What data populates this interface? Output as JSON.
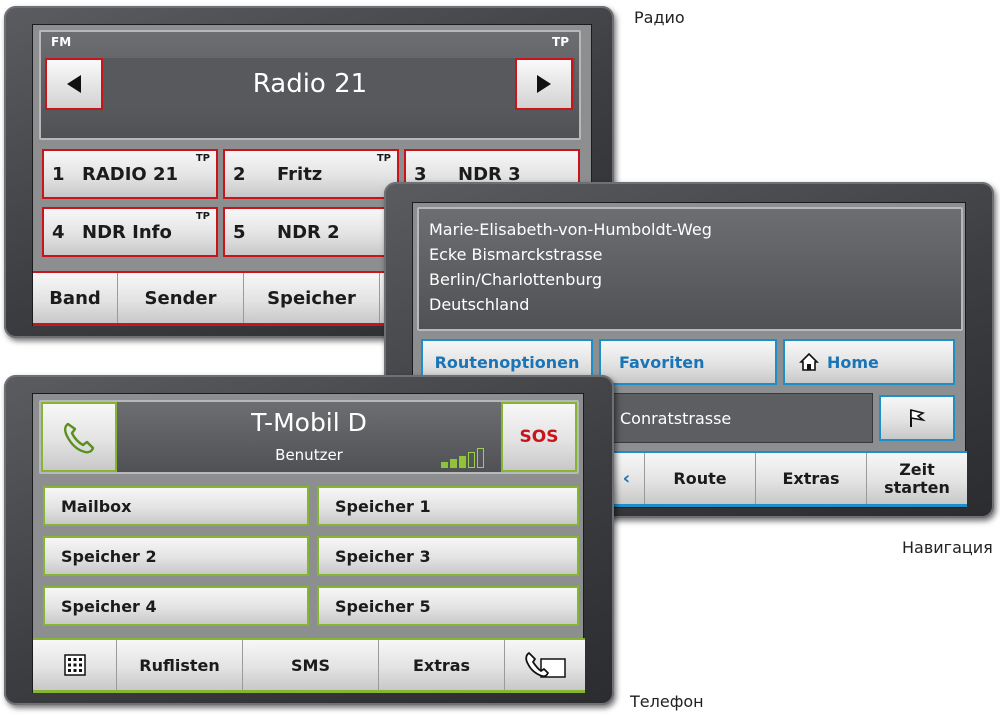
{
  "captions": {
    "radio": "Радио",
    "navigation": "Навигация",
    "phone": "Телефон"
  },
  "radio": {
    "band_indicator": "FM",
    "tp_indicator": "TP",
    "station_name": "Radio 21",
    "presets": [
      {
        "number": "1",
        "name": "RADIO 21",
        "tp": "TP"
      },
      {
        "number": "2",
        "name": "Fritz",
        "tp": "TP"
      },
      {
        "number": "3",
        "name": "NDR 3",
        "tp": ""
      },
      {
        "number": "4",
        "name": "NDR Info",
        "tp": "TP"
      },
      {
        "number": "5",
        "name": "NDR 2",
        "tp": ""
      }
    ],
    "bottom_tabs": [
      "Band",
      "Sender",
      "Speicher"
    ],
    "accent_color": "#c8141a"
  },
  "navigation": {
    "address_lines": [
      "Marie-Elisabeth-von-Humboldt-Weg",
      "Ecke Bismarckstrasse",
      "Berlin/Charlottenburg",
      "Deutschland"
    ],
    "buttons": {
      "route_options": "Routenoptionen",
      "favorites": "Favoriten",
      "home": "Home"
    },
    "next_street": "Conratstrasse",
    "bottom_tabs": {
      "route": "Route",
      "extras": "Extras",
      "start_time_line1": "Zeit",
      "start_time_line2": "starten"
    },
    "accent_color": "#1e8ec8"
  },
  "phone": {
    "network": "T-Mobil D",
    "user": "Benutzer",
    "sos": "SOS",
    "signal_bars_total": 5,
    "signal_bars_filled": 3,
    "speed_dials": [
      "Mailbox",
      "Speicher 1",
      "Speicher 2",
      "Speicher 3",
      "Speicher 4",
      "Speicher 5"
    ],
    "bottom_tabs": {
      "keypad_icon": "keypad-icon",
      "call_lists": "Ruflisten",
      "sms": "SMS",
      "extras": "Extras",
      "hangup_icon": "phone-hangup-icon"
    },
    "accent_color": "#86b532"
  }
}
